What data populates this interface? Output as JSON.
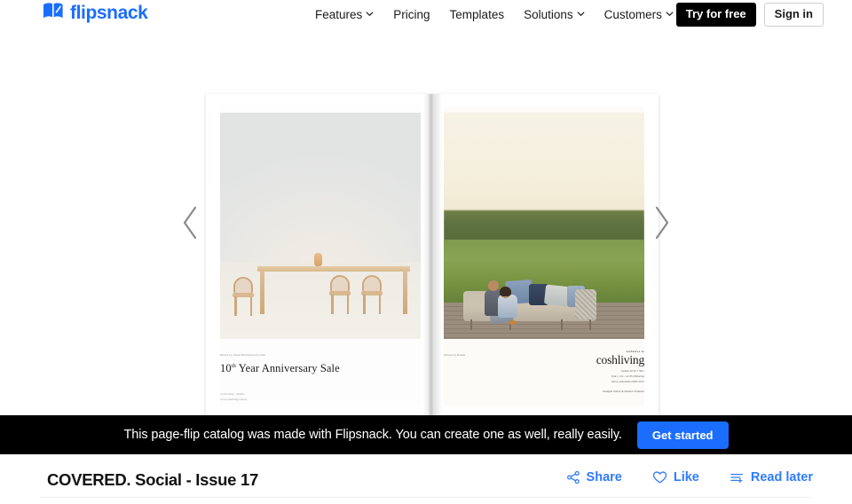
{
  "brand": {
    "name": "flipsnack",
    "logo_icon": "book-logo-icon",
    "color": "#1a6dff"
  },
  "header": {
    "nav": [
      {
        "label": "Features",
        "has_caret": true
      },
      {
        "label": "Pricing",
        "has_caret": false
      },
      {
        "label": "Templates",
        "has_caret": false
      },
      {
        "label": "Solutions",
        "has_caret": true
      },
      {
        "label": "Customers",
        "has_caret": true
      }
    ],
    "try_free_label": "Try for free",
    "sign_in_label": "Sign in"
  },
  "viewer": {
    "prev_icon": "chevron-left-icon",
    "next_icon": "chevron-right-icon",
    "left_page": {
      "credit": "Dinary by Justin Hutchinson for Kett",
      "headline_number": "10",
      "headline_sup": "th",
      "headline_rest": "Year  Anniversary Sale",
      "footnote_line1": "Cosh Living  -  Sydney",
      "footnote_line2": "www.coshliving.com.au"
    },
    "right_page": {
      "credit": "Bastone by Manutti",
      "eyebrow": "exclusive to",
      "brand": "coshliving",
      "address_line1": "Sydney 02 02 7 3011",
      "address_line2": "Unit 1, 5/4 - 14, 85 O'Riordan",
      "address_line3": "Drive, Alexandria NSW 2015",
      "tagline": "Designer Indoor & Outdoor Furniture"
    }
  },
  "promo": {
    "message": "This page-flip catalog was made with Flipsnack. You can create one as well, really easily.",
    "button_label": "Get started",
    "button_color": "#1a6dff",
    "background": "#000000"
  },
  "footer": {
    "document_title": "COVERED. Social - Issue 17",
    "actions": [
      {
        "label": "Share",
        "icon": "share-icon"
      },
      {
        "label": "Like",
        "icon": "heart-icon"
      },
      {
        "label": "Read later",
        "icon": "read-later-icon"
      }
    ],
    "accent_color": "#2e7bff"
  }
}
